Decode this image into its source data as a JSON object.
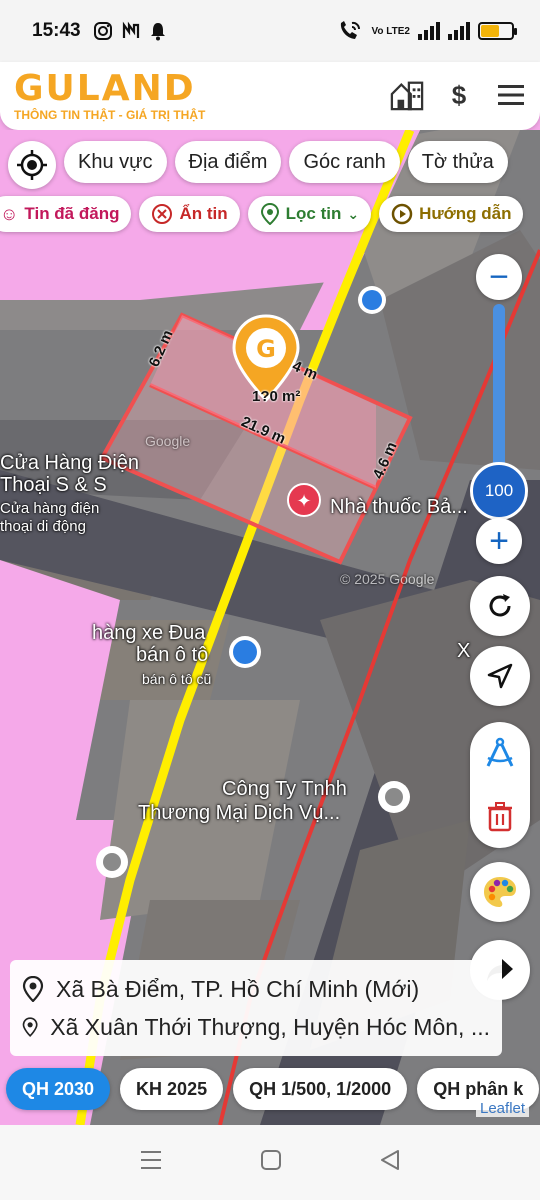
{
  "status": {
    "time": "15:43",
    "volte": "Vo LTE2"
  },
  "header": {
    "brand": "GULAND",
    "tagline": "THÔNG TIN THẬT - GIÁ TRỊ THẬT",
    "actions": [
      "building-icon",
      "dollar-icon",
      "menu-icon"
    ]
  },
  "search_chips": [
    "Khu vực",
    "Địa điểm",
    "Góc ranh",
    "Tờ thửa"
  ],
  "filter_chips": [
    {
      "label": "Tin đã đăng",
      "color": "#c2185b"
    },
    {
      "label": "Ẩn tin",
      "color": "#c62828"
    },
    {
      "label": "Lọc tin",
      "color": "#2e7d32"
    },
    {
      "label": "Hướng dẫn",
      "color": "#8d6e00"
    }
  ],
  "map": {
    "parcel": {
      "area": "1?0 m²",
      "dims": [
        "6.2 m",
        "4 m",
        "21.9 m",
        "4.6 m"
      ]
    },
    "labels": {
      "shop1": "Cửa Hàng Điện",
      "shop1b": "Thoại S & S",
      "shop1c": "Cửa hàng điện",
      "shop1d": "thoại di động",
      "pharmacy": "Nhà thuốc Bả...",
      "car1": "hàng xe Đua",
      "car2": "bán ô tô",
      "car3": "bán ô tô cũ",
      "company1": "Công Ty Tnhh",
      "company2": "Thương Mại Dịch Vụ...",
      "watermark": "© 2025 Google",
      "google": "Google",
      "road": "X"
    },
    "zoom_level": "100"
  },
  "address": {
    "line1": "Xã Bà Điểm, TP. Hồ Chí Minh (Mới)",
    "line2": "Xã Xuân Thới Thượng, Huyện Hóc Môn, ..."
  },
  "plans": [
    "QH 2030",
    "KH 2025",
    "QH 1/500, 1/2000",
    "QH phân k"
  ],
  "plans_active": "QH 2030",
  "attribution": "Leaflet",
  "colors": {
    "accent": "#f5a623",
    "active_plan": "#1e88e5",
    "zone_pink": "#f5a9e9",
    "boundary_yellow": "#ffee00",
    "boundary_red": "#e53935",
    "zoom_blue": "#1e63c5"
  }
}
